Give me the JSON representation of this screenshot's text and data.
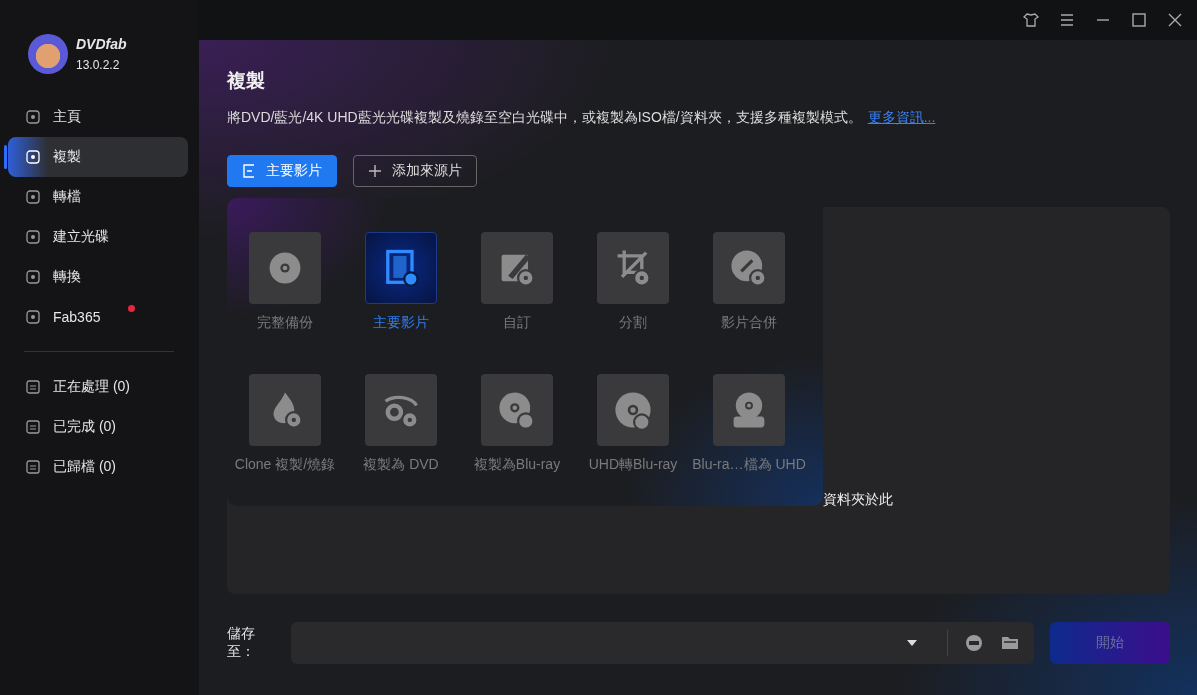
{
  "app": {
    "name": "DVDfab",
    "version": "13.0.2.2"
  },
  "sidebar": {
    "items": [
      {
        "label": "主頁",
        "selected": false,
        "badge": false
      },
      {
        "label": "複製",
        "selected": true,
        "badge": false
      },
      {
        "label": "轉檔",
        "selected": false,
        "badge": false
      },
      {
        "label": "建立光碟",
        "selected": false,
        "badge": false
      },
      {
        "label": "轉換",
        "selected": false,
        "badge": false
      },
      {
        "label": "Fab365",
        "selected": false,
        "badge": true
      }
    ],
    "queue": [
      {
        "label": "正在處理 (0)"
      },
      {
        "label": "已完成 (0)"
      },
      {
        "label": "已歸檔 (0)"
      }
    ]
  },
  "page": {
    "title": "複製",
    "description": "將DVD/藍光/4K UHD藍光光碟複製及燒錄至空白光碟中，或複製為ISO檔/資料夾，支援多種複製模式。",
    "more_link": "更多資訊..."
  },
  "toolbar": {
    "mode_button": "主要影片",
    "add_source_button": "添加來源片"
  },
  "modes": [
    {
      "label": "完整備份",
      "selected": false
    },
    {
      "label": "主要影片",
      "selected": true
    },
    {
      "label": "自訂",
      "selected": false
    },
    {
      "label": "分割",
      "selected": false
    },
    {
      "label": "影片合併",
      "selected": false
    },
    {
      "label": "Clone 複製/燒錄",
      "selected": false
    },
    {
      "label": "複製為 DVD",
      "selected": false
    },
    {
      "label": "複製為Blu-ray",
      "selected": false
    },
    {
      "label": "UHD轉Blu-ray",
      "selected": false
    },
    {
      "label": "Blu-ra…檔為 UHD",
      "selected": false
    }
  ],
  "drop_zone": {
    "hint": "資料夾於此"
  },
  "output": {
    "label": "儲存至：",
    "start_button": "開始",
    "start_disabled": true
  }
}
